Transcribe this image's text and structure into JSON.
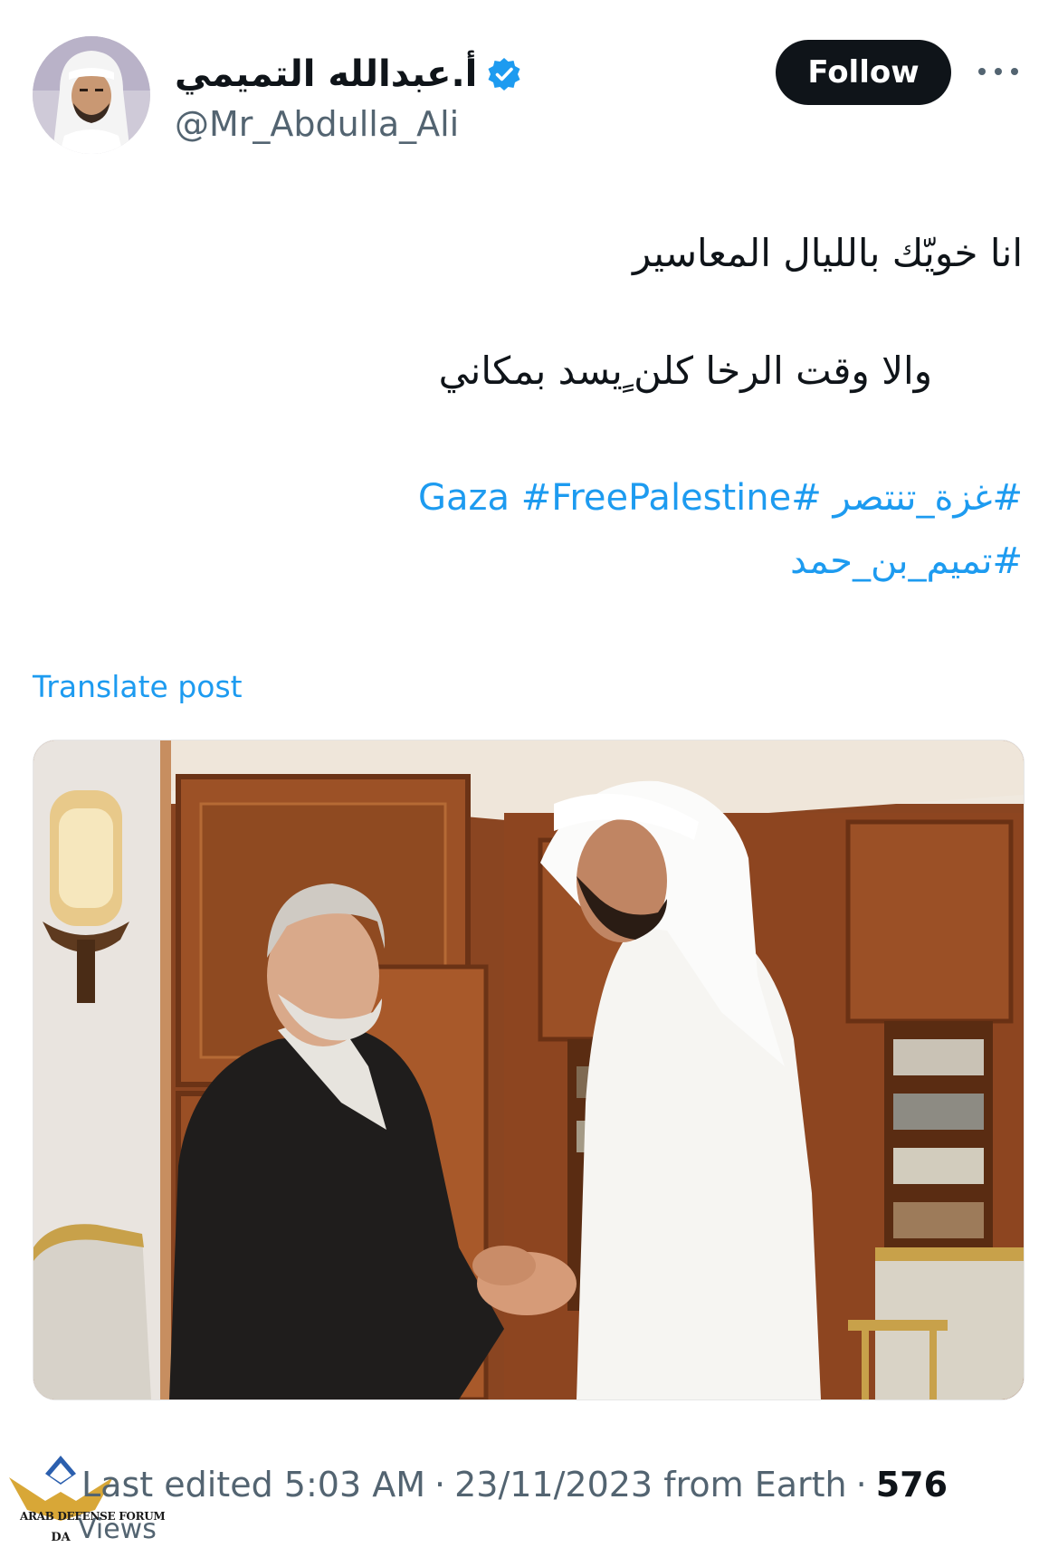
{
  "author": {
    "display_name": "أ.عبدالله التميمي",
    "handle": "@Mr_Abdulla_Ali",
    "verified": true,
    "avatar_icon": "profile-photo"
  },
  "actions": {
    "follow_label": "Follow",
    "more_icon": "more-horizontal-icon"
  },
  "tweet": {
    "line1": "انا خويّك بالليال المعاسير",
    "line2": "والا وقت الرخا كلن ٍيسد بمكاني",
    "hashtags_line1": [
      "#غزة_تنتصر",
      "#Gaza",
      "#FreePalestine"
    ],
    "hashtags_line2": [
      "#تميم_بن_حمد"
    ],
    "translate_label": "Translate post"
  },
  "media": {
    "type": "photo"
  },
  "footer": {
    "edited_label": "Last edited",
    "time": "5:03 AM",
    "date": "23/11/2023",
    "from": "from Earth",
    "views_count": "576",
    "views_label": "Views"
  },
  "watermark": {
    "text": "ARAB DEFENSE FORUM",
    "logo_text": "DA"
  },
  "colors": {
    "link": "#1d9bf0",
    "verified": "#1d9bf0",
    "text": "#0f1419",
    "secondary": "#536471",
    "button_bg": "#0f1419"
  }
}
